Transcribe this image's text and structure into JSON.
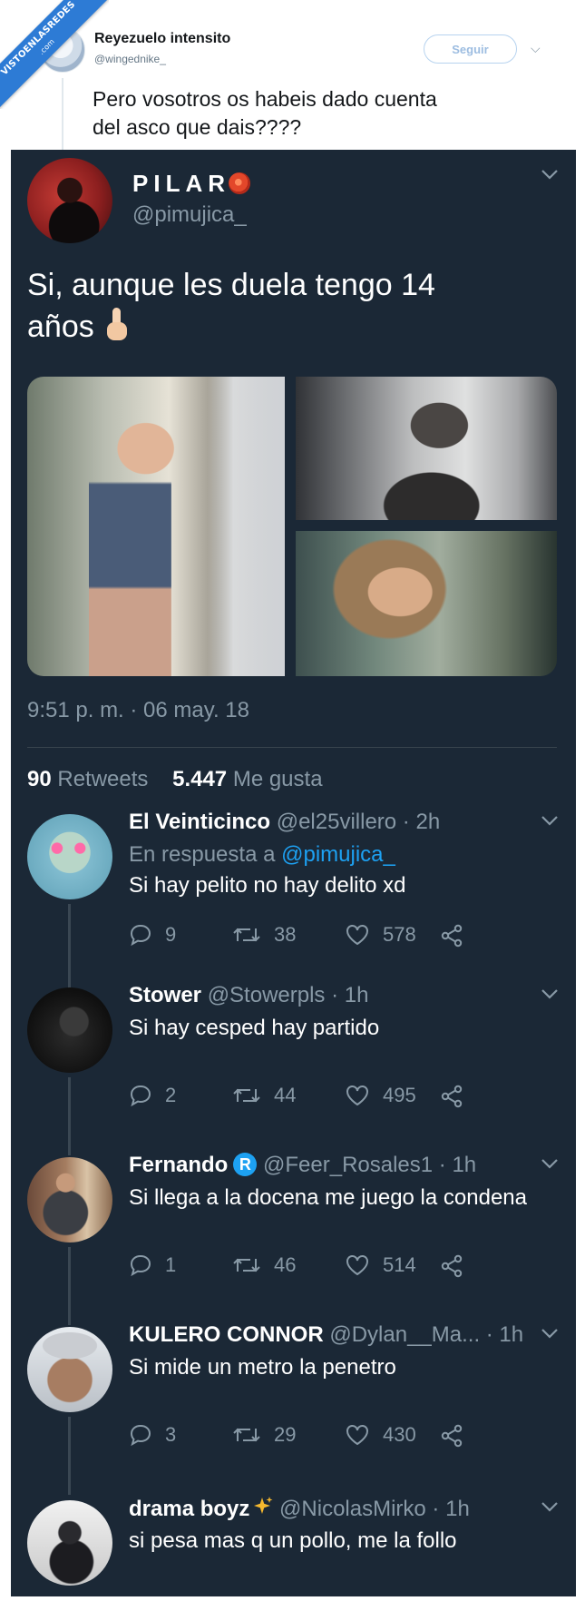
{
  "watermark": {
    "line1": "VISTOENLASREDES",
    "line2": ".com"
  },
  "top_tweet": {
    "name": "Reyezuelo intensito",
    "handle": "@wingednike_",
    "follow_label": "Seguir",
    "text_line1": "Pero vosotros os habeis dado cuenta",
    "text_line2": "del asco que dais????"
  },
  "main_tweet": {
    "name": "PILAR",
    "handle": "@pimujica_",
    "text_line1": "Si, aunque les duela tengo 14",
    "text_line2": "años",
    "time": "9:51 p. m. · 06 may. 18",
    "retweets_count": "90",
    "retweets_label": "Retweets",
    "likes_count": "5.447",
    "likes_label": "Me gusta"
  },
  "replies": [
    {
      "name": "El Veinticinco",
      "handle": "@el25villero · 2h",
      "reply_to_label": "En respuesta a",
      "reply_to_handle": "@pimujica_",
      "text": "Si hay pelito no hay delito xd",
      "replies": "9",
      "retweets": "38",
      "likes": "578"
    },
    {
      "name": "Stower",
      "handle": "@Stowerpls · 1h",
      "text": "Si hay cesped hay partido",
      "replies": "2",
      "retweets": "44",
      "likes": "495"
    },
    {
      "name": "Fernando",
      "badge": "R",
      "handle": "@Feer_Rosales1 · 1h",
      "text": "Si llega a la docena me juego la condena",
      "replies": "1",
      "retweets": "46",
      "likes": "514"
    },
    {
      "name": "KULERO CONNOR",
      "handle": "@Dylan__Ma... · 1h",
      "text": "Si mide un metro la penetro",
      "replies": "3",
      "retweets": "29",
      "likes": "430"
    },
    {
      "name": "drama boyz",
      "handle": "@NicolasMirko · 1h",
      "text": "si pesa mas q un pollo, me la follo"
    }
  ],
  "icons": {
    "reply": "comment-bubble-icon",
    "retweet": "retweet-arrows-icon",
    "like": "heart-icon",
    "share": "share-nodes-icon",
    "more": "chevron-down-icon"
  },
  "colors": {
    "dark_bg": "#1b2836",
    "muted": "#8899a6",
    "link": "#1da1f2",
    "divider": "#38444d"
  }
}
